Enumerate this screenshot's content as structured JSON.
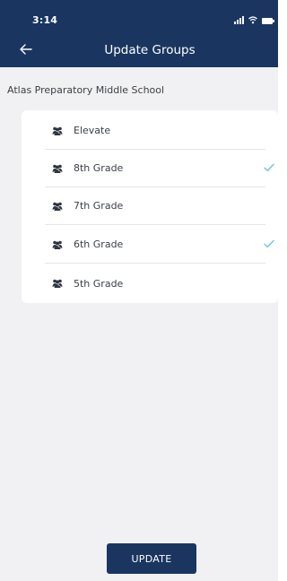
{
  "status_bar": {
    "time": "3:14",
    "icons": [
      "signal-icon",
      "wifi-icon",
      "battery-icon"
    ]
  },
  "header": {
    "title": "Update Groups",
    "back_icon": "arrow-left-icon"
  },
  "school_name": "Atlas Preparatory Middle School",
  "groups": [
    {
      "label": "Elevate",
      "icon": "group-icon",
      "selected": false
    },
    {
      "label": "8th Grade",
      "icon": "group-icon",
      "selected": true
    },
    {
      "label": "7th Grade",
      "icon": "group-icon",
      "selected": false
    },
    {
      "label": "6th Grade",
      "icon": "group-icon",
      "selected": true
    },
    {
      "label": "5th Grade",
      "icon": "group-icon",
      "selected": false
    }
  ],
  "actions": {
    "update_label": "UPDATE"
  },
  "colors": {
    "header_bg": "#1a3660",
    "page_bg": "#f1f1f3",
    "check": "#6fc3e6",
    "button_bg": "#1a3660"
  }
}
